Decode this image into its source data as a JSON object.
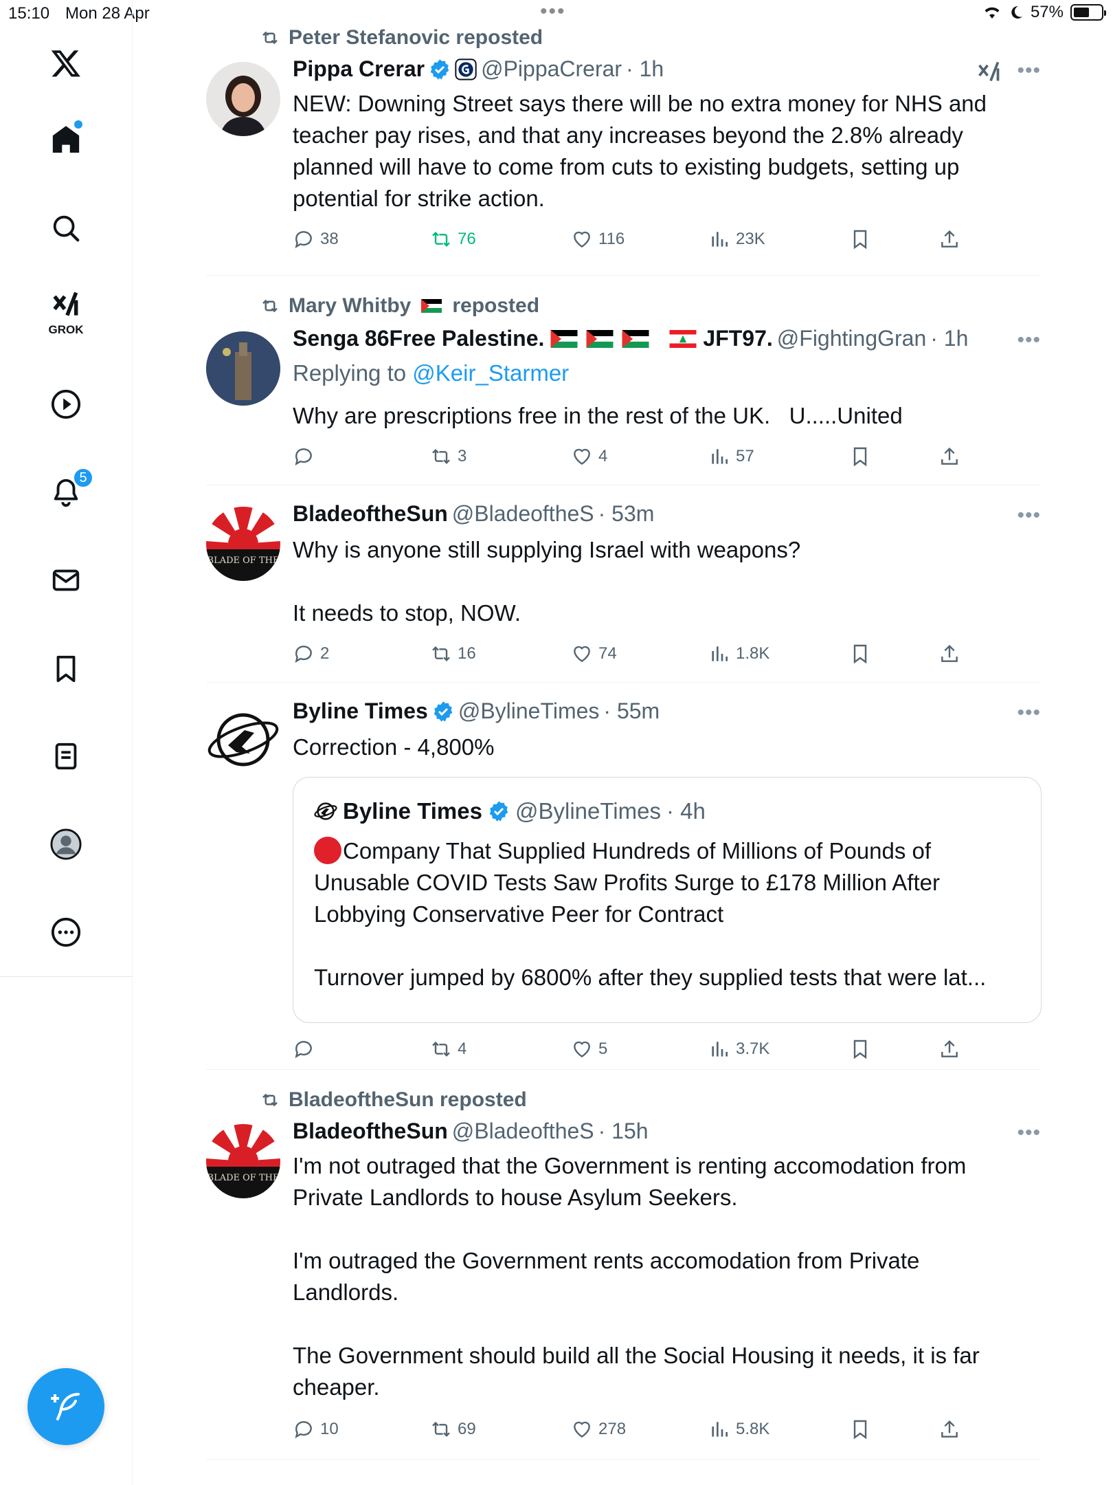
{
  "status_bar": {
    "time": "15:10",
    "date": "Mon 28 Apr",
    "battery": "57%",
    "battery_level": 0.57
  },
  "sidebar": {
    "grok_label": "GROK",
    "notifications_badge": "5"
  },
  "tweets": [
    {
      "repost_by": "Peter Stefanovic reposted",
      "name": "Pippa Crerar",
      "handle": "@PippaCrerar",
      "time": "· 1h",
      "text": "NEW: Downing Street says there will be no extra money for NHS and teacher pay rises, and that any increases beyond the 2.8% already planned will have to come from cuts to existing budgets, setting up potential for strike action.",
      "replies": "38",
      "reposts": "76",
      "likes": "116",
      "views": "23K"
    },
    {
      "repost_by": "Mary Whitby",
      "repost_suffix": "reposted",
      "name": "Senga 86Free Palestine.",
      "name_suffix": "JFT97.",
      "handle": "@FightingGran",
      "time": "· 1h",
      "replying_label": "Replying to",
      "replying_to": "@Keir_Starmer",
      "text": "Why are prescriptions free in the rest of the UK.   U.....United",
      "replies": "",
      "reposts": "3",
      "likes": "4",
      "views": "57"
    },
    {
      "name": "BladeoftheSun",
      "handle": "@BladeoftheS",
      "time": "· 53m",
      "avatar_text": "BLADE OF THE",
      "text": "Why is anyone still supplying Israel with weapons?\n\nIt needs to stop, NOW.",
      "replies": "2",
      "reposts": "16",
      "likes": "74",
      "views": "1.8K"
    },
    {
      "name": "Byline Times",
      "handle": "@BylineTimes",
      "time": "· 55m",
      "text": "Correction - 4,800%",
      "quote": {
        "name": "Byline Times",
        "handle": "@BylineTimes",
        "time": "· 4h",
        "text": "Company That Supplied Hundreds of Millions of Pounds of Unusable COVID Tests Saw Profits Surge to £178 Million After Lobbying Conservative Peer for Contract\n\nTurnover jumped by 6800% after they supplied tests that were lat..."
      },
      "replies": "",
      "reposts": "4",
      "likes": "5",
      "views": "3.7K"
    },
    {
      "repost_by": "BladeoftheSun reposted",
      "name": "BladeoftheSun",
      "handle": "@BladeoftheS",
      "time": "· 15h",
      "avatar_text": "BLADE OF THE",
      "text": "I'm not outraged that the Government is renting accomodation from Private Landlords to house Asylum Seekers.\n\nI'm outraged the Government rents accomodation from Private Landlords.\n\nThe Government should build all the Social Housing it needs, it is far cheaper.",
      "replies": "10",
      "reposts": "69",
      "likes": "278",
      "views": "5.8K"
    }
  ],
  "colors": {
    "accent": "#1d9bf0",
    "repost_active": "#00ba7c",
    "muted": "#536471"
  }
}
